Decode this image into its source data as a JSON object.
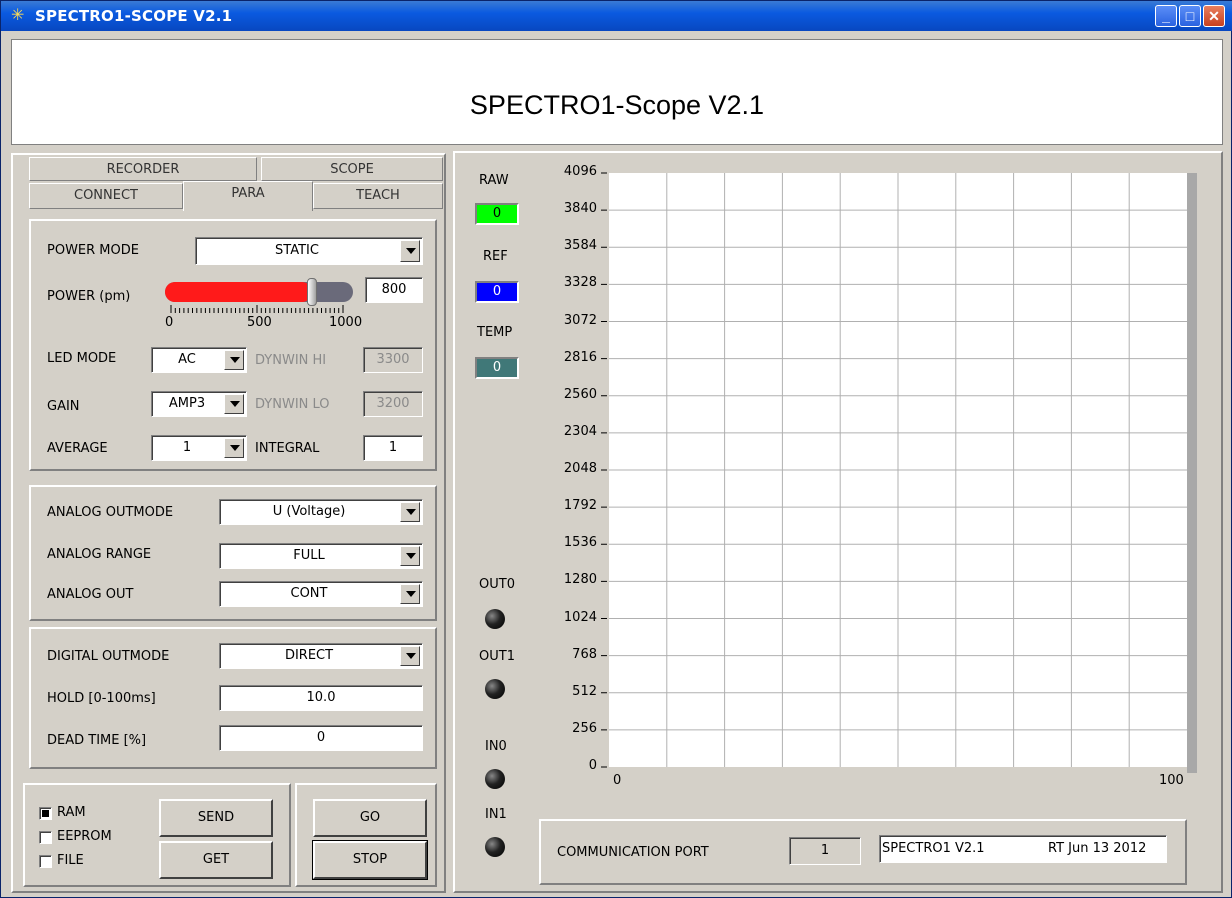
{
  "window": {
    "title": "SPECTRO1-SCOPE V2.1"
  },
  "header": {
    "title": "SPECTRO1-Scope V2.1"
  },
  "tabs": {
    "recorder": "RECORDER",
    "scope": "SCOPE",
    "connect": "CONNECT",
    "para": "PARA",
    "teach": "TEACH"
  },
  "power": {
    "mode_label": "POWER MODE",
    "mode_value": "STATIC",
    "power_label": "POWER (pm)",
    "power_value": "800",
    "power_fraction": 0.8,
    "scale_min": "0",
    "scale_mid": "500",
    "scale_max": "1000"
  },
  "led": {
    "label": "LED MODE",
    "value": "AC",
    "dynwin_hi_label": "DYNWIN HI",
    "dynwin_hi_value": "3300"
  },
  "gain": {
    "label": "GAIN",
    "value": "AMP3",
    "dynwin_lo_label": "DYNWIN LO",
    "dynwin_lo_value": "3200"
  },
  "average": {
    "label": "AVERAGE",
    "value": "1",
    "integral_label": "INTEGRAL",
    "integral_value": "1"
  },
  "analog": {
    "outmode_label": "ANALOG OUTMODE",
    "outmode_value": "U (Voltage)",
    "range_label": "ANALOG RANGE",
    "range_value": "FULL",
    "out_label": "ANALOG OUT",
    "out_value": "CONT"
  },
  "digital": {
    "outmode_label": "DIGITAL OUTMODE",
    "outmode_value": "DIRECT",
    "hold_label": "HOLD [0-100ms]",
    "hold_value": "10.0",
    "dead_label": "DEAD TIME [%]",
    "dead_value": "0"
  },
  "storage": {
    "ram": "RAM",
    "eeprom": "EEPROM",
    "file": "FILE"
  },
  "buttons": {
    "send": "SEND",
    "get": "GET",
    "go": "GO",
    "stop": "STOP"
  },
  "indicators": {
    "raw_label": "RAW",
    "raw_value": "0",
    "raw_color": "#00ff00",
    "ref_label": "REF",
    "ref_value": "0",
    "ref_color": "#0000ff",
    "temp_label": "TEMP",
    "temp_value": "0",
    "temp_color": "#407878"
  },
  "io": {
    "out0": "OUT0",
    "out1": "OUT1",
    "in0": "IN0",
    "in1": "IN1"
  },
  "chart_data": {
    "type": "line",
    "series": [],
    "y_ticks": [
      "4096",
      "3840",
      "3584",
      "3328",
      "3072",
      "2816",
      "2560",
      "2304",
      "2048",
      "1792",
      "1536",
      "1280",
      "1024",
      "768",
      "512",
      "256",
      "0"
    ],
    "x_ticks": [
      "0",
      "100"
    ],
    "ylim": [
      0,
      4096
    ],
    "xlim": [
      0,
      100
    ],
    "grid": true
  },
  "comm": {
    "label": "COMMUNICATION PORT",
    "port": "1",
    "info_a": "SPECTRO1 V2.1",
    "info_b": "RT Jun 13 2012"
  }
}
